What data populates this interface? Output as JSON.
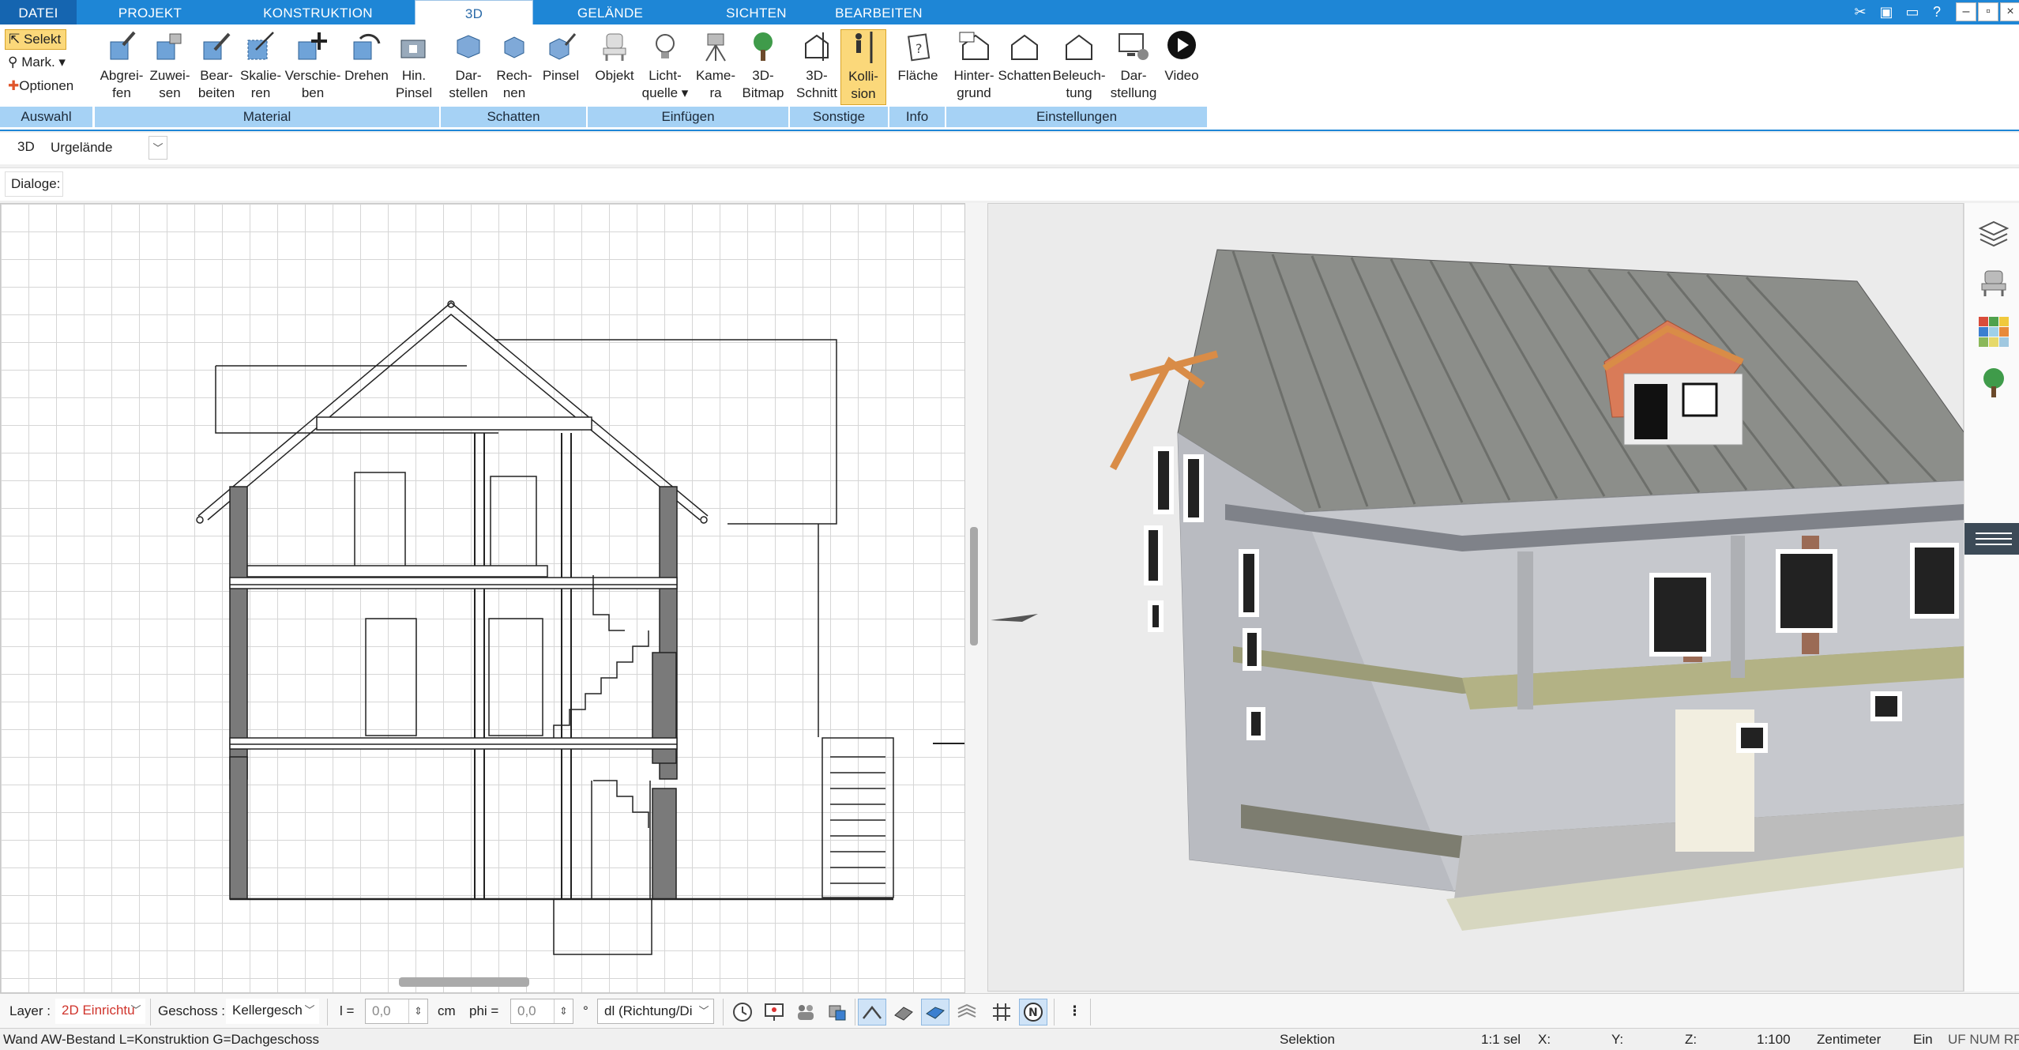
{
  "menu": {
    "tabs": [
      {
        "label": "DATEI"
      },
      {
        "label": "PROJEKT"
      },
      {
        "label": "KONSTRUKTION"
      },
      {
        "label": "3D"
      },
      {
        "label": "GELÄNDE"
      },
      {
        "label": "SICHTEN"
      },
      {
        "label": "BEARBEITEN"
      }
    ],
    "active": "3D"
  },
  "ribbon": {
    "auswahl": {
      "selekt": "Selekt",
      "mark": "Mark.",
      "optionen": "Optionen",
      "group": "Auswahl"
    },
    "material": {
      "buttons": [
        {
          "line1": "Abgrei-",
          "line2": "fen"
        },
        {
          "line1": "Zuwei-",
          "line2": "sen"
        },
        {
          "line1": "Bear-",
          "line2": "beiten"
        },
        {
          "line1": "Skalie-",
          "line2": "ren"
        },
        {
          "line1": "Verschie-",
          "line2": "ben"
        },
        {
          "line1": "Drehen",
          "line2": ""
        },
        {
          "line1": "Hin.",
          "line2": "Pinsel"
        }
      ],
      "group": "Material"
    },
    "schatten": {
      "buttons": [
        {
          "line1": "Dar-",
          "line2": "stellen"
        },
        {
          "line1": "Rech-",
          "line2": "nen"
        },
        {
          "line1": "Pinsel",
          "line2": ""
        }
      ],
      "group": "Schatten"
    },
    "einfuegen": {
      "buttons": [
        {
          "line1": "Objekt",
          "line2": ""
        },
        {
          "line1": "Licht-",
          "line2": "quelle ▾"
        },
        {
          "line1": "Kame-",
          "line2": "ra"
        },
        {
          "line1": "3D-",
          "line2": "Bitmap"
        }
      ],
      "group": "Einfügen"
    },
    "sonstige": {
      "buttons": [
        {
          "line1": "3D-",
          "line2": "Schnitt"
        },
        {
          "line1": "Kolli-",
          "line2": "sion"
        }
      ],
      "group": "Sonstige"
    },
    "info": {
      "buttons": [
        {
          "line1": "Fläche",
          "line2": ""
        }
      ],
      "group": "Info"
    },
    "einstellungen": {
      "buttons": [
        {
          "line1": "Hinter-",
          "line2": "grund"
        },
        {
          "line1": "Schatten",
          "line2": ""
        },
        {
          "line1": "Beleuch-",
          "line2": "tung"
        },
        {
          "line1": "Dar-",
          "line2": "stellung"
        },
        {
          "line1": "Video",
          "line2": ""
        }
      ],
      "group": "Einstellungen"
    }
  },
  "subtoolbar": {
    "mode_label": "3D",
    "terrain_value": "Urgelände",
    "dialoge_label": "Dialoge:"
  },
  "bottombar": {
    "layer_label": "Layer :",
    "layer_value": "2D Einrichtu",
    "geschoss_label": "Geschoss :",
    "geschoss_value": "Kellergesch",
    "l_label": "l =",
    "l_value": "0,0",
    "l_unit": "cm",
    "phi_label": "phi =",
    "phi_value": "0,0",
    "phi_unit": "°",
    "direction_value": "dl (Richtung/Di",
    "menu_glyph": "⋮"
  },
  "statusbar": {
    "left_text": "Wand AW-Bestand L=Konstruktion G=Dachgeschoss",
    "mode": "Selektion",
    "sel": "1:1 sel",
    "x": "X:",
    "y": "Y:",
    "z": "Z:",
    "scale": "1:100",
    "unit": "Zentimeter",
    "ein": "Ein",
    "flags": "UF NUM RF"
  },
  "colors": {
    "accent": "#1e86d6",
    "group_bg": "#a6d2f5",
    "active_tool": "#fbd87a"
  }
}
